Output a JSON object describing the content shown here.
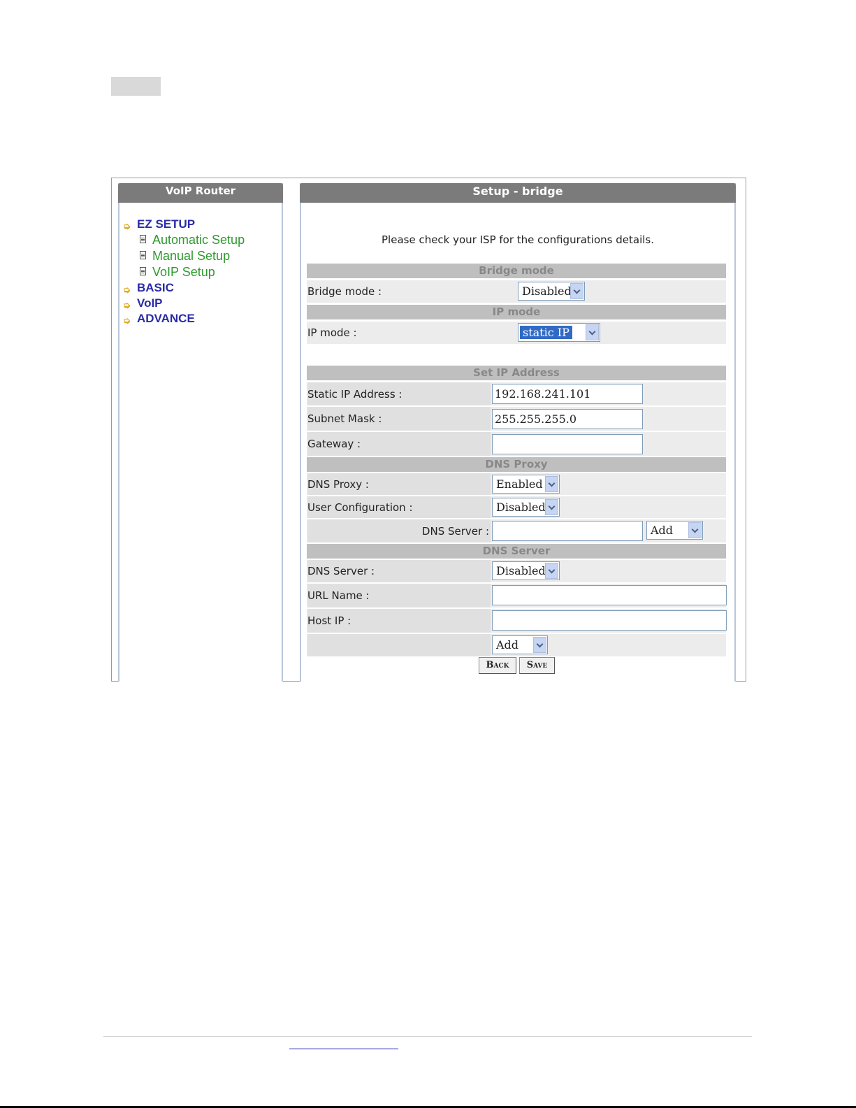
{
  "sidebar": {
    "title": "VoIP Router",
    "menu": {
      "ez_setup": "EZ SETUP",
      "automatic_setup": "Automatic Setup",
      "manual_setup": "Manual Setup",
      "voip_setup": "VoIP Setup",
      "basic": "BASIC",
      "voip": "VoIP",
      "advance": "ADVANCE"
    }
  },
  "main": {
    "title": "Setup - bridge",
    "notice": "Please check your ISP for the configurations details."
  },
  "form": {
    "bridge_section": "Bridge mode",
    "bridge_label": "Bridge mode :",
    "bridge_value": "Disabled",
    "ip_section": "IP mode",
    "ip_label": "IP mode :",
    "ip_value": "static IP",
    "setip_section": "Set IP Address",
    "static_ip_label": "Static IP Address :",
    "static_ip_value": "192.168.241.101",
    "subnet_label": "Subnet Mask :",
    "subnet_value": "255.255.255.0",
    "gateway_label": "Gateway :",
    "gateway_value": "",
    "dnsproxy_section": "DNS Proxy",
    "dnsproxy_label": "DNS Proxy :",
    "dnsproxy_value": "Enabled",
    "usercfg_label": "User Configuration :",
    "usercfg_value": "Disabled",
    "dnsserver_label": "DNS Server :",
    "dnsserver_input": "",
    "dnsserver_add": "Add",
    "dnsserver_section": "DNS Server",
    "dnsserver2_label": "DNS Server :",
    "dnsserver2_value": "Disabled",
    "url_label": "URL Name :",
    "url_value": "",
    "hostip_label": "Host IP :",
    "hostip_value": "",
    "host_add": "Add",
    "back_button": "Back",
    "save_button": "Save"
  }
}
